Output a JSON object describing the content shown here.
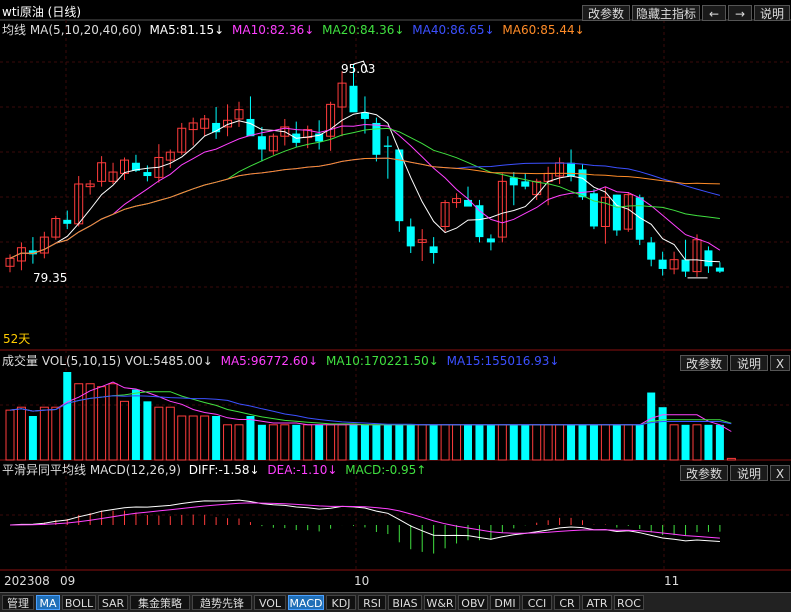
{
  "header": {
    "title": "wti原油 (日线)",
    "buttons": [
      "改参数",
      "隐藏主指标",
      "←",
      "→",
      "说明"
    ]
  },
  "ma_legend": {
    "label": "均线 MA(5,10,20,40,60)",
    "items": [
      {
        "text": "MA5:81.15↓",
        "color": "#ffffff"
      },
      {
        "text": "MA10:82.36↓",
        "color": "#ff40ff"
      },
      {
        "text": "MA20:84.36↓",
        "color": "#40e040"
      },
      {
        "text": "MA40:86.65↓",
        "color": "#3c50ff"
      },
      {
        "text": "MA60:85.44↓",
        "color": "#ff8c28"
      }
    ]
  },
  "price_annotations": {
    "high": "95.03",
    "low": "79.35",
    "days": "52天"
  },
  "vol_legend": {
    "label": "成交量 VOL(5,10,15) VOL:5485.00↓",
    "items": [
      {
        "text": "MA5:96772.60↓",
        "color": "#ff40ff"
      },
      {
        "text": "MA10:170221.50↓",
        "color": "#40e040"
      },
      {
        "text": "MA15:155016.93↓",
        "color": "#3c50ff"
      }
    ],
    "buttons": [
      "改参数",
      "说明",
      "X"
    ]
  },
  "macd_legend": {
    "label": "平滑异同平均线 MACD(12,26,9)",
    "items": [
      {
        "text": "DIFF:-1.58↓",
        "color": "#ffffff"
      },
      {
        "text": "DEA:-1.10↓",
        "color": "#ff40ff"
      },
      {
        "text": "MACD:-0.95↑",
        "color": "#40e040"
      }
    ],
    "buttons": [
      "改参数",
      "说明",
      "X"
    ]
  },
  "time_axis": {
    "labels": [
      "202308",
      "09",
      "10",
      "11"
    ]
  },
  "tabs": [
    "管理",
    "MA",
    "BOLL",
    "SAR",
    "集金策略",
    "趋势先锋",
    "VOL",
    "MACD",
    "KDJ",
    "RSI",
    "BIAS",
    "W&R",
    "OBV",
    "DMI",
    "CCI",
    "CR",
    "ATR",
    "ROC"
  ],
  "active_tabs": [
    "MA",
    "MACD"
  ],
  "chart_data": [
    {
      "type": "candlestick",
      "ylim": [
        75,
        97
      ],
      "candles": [
        {
          "o": 79.8,
          "h": 80.7,
          "l": 79.35,
          "c": 80.4
        },
        {
          "o": 80.2,
          "h": 81.6,
          "l": 79.5,
          "c": 81.2
        },
        {
          "o": 81.0,
          "h": 82.0,
          "l": 80.0,
          "c": 80.7
        },
        {
          "o": 80.8,
          "h": 82.4,
          "l": 80.4,
          "c": 82.0
        },
        {
          "o": 82.0,
          "h": 83.6,
          "l": 81.8,
          "c": 83.4
        },
        {
          "o": 83.3,
          "h": 84.0,
          "l": 82.6,
          "c": 83.0
        },
        {
          "o": 83.0,
          "h": 86.6,
          "l": 82.8,
          "c": 86.0
        },
        {
          "o": 85.8,
          "h": 86.3,
          "l": 85.2,
          "c": 86.0
        },
        {
          "o": 86.2,
          "h": 88.1,
          "l": 85.8,
          "c": 87.6
        },
        {
          "o": 86.2,
          "h": 87.6,
          "l": 86.0,
          "c": 86.9
        },
        {
          "o": 86.8,
          "h": 88.0,
          "l": 86.3,
          "c": 87.8
        },
        {
          "o": 87.6,
          "h": 88.2,
          "l": 86.9,
          "c": 87.0
        },
        {
          "o": 86.9,
          "h": 87.4,
          "l": 86.2,
          "c": 86.6
        },
        {
          "o": 86.5,
          "h": 89.0,
          "l": 86.1,
          "c": 88.0
        },
        {
          "o": 87.8,
          "h": 88.6,
          "l": 87.2,
          "c": 88.4
        },
        {
          "o": 88.4,
          "h": 90.6,
          "l": 88.2,
          "c": 90.2
        },
        {
          "o": 90.1,
          "h": 91.0,
          "l": 88.9,
          "c": 90.6
        },
        {
          "o": 90.2,
          "h": 91.2,
          "l": 89.6,
          "c": 90.9
        },
        {
          "o": 90.6,
          "h": 91.8,
          "l": 89.4,
          "c": 89.9
        },
        {
          "o": 90.3,
          "h": 92.0,
          "l": 89.6,
          "c": 90.8
        },
        {
          "o": 90.9,
          "h": 92.2,
          "l": 90.3,
          "c": 91.6
        },
        {
          "o": 90.9,
          "h": 92.6,
          "l": 90.1,
          "c": 89.6
        },
        {
          "o": 89.6,
          "h": 90.3,
          "l": 87.7,
          "c": 88.6
        },
        {
          "o": 88.5,
          "h": 89.8,
          "l": 88.2,
          "c": 89.6
        },
        {
          "o": 89.6,
          "h": 90.9,
          "l": 88.9,
          "c": 90.3
        },
        {
          "o": 89.8,
          "h": 90.7,
          "l": 88.8,
          "c": 89.1
        },
        {
          "o": 89.5,
          "h": 90.4,
          "l": 88.7,
          "c": 90.1
        },
        {
          "o": 89.8,
          "h": 90.8,
          "l": 88.6,
          "c": 89.2
        },
        {
          "o": 89.6,
          "h": 92.2,
          "l": 88.5,
          "c": 92.0
        },
        {
          "o": 91.8,
          "h": 94.5,
          "l": 89.6,
          "c": 93.6
        },
        {
          "o": 93.4,
          "h": 95.03,
          "l": 92.0,
          "c": 91.4
        },
        {
          "o": 91.4,
          "h": 92.6,
          "l": 89.8,
          "c": 90.9
        },
        {
          "o": 90.6,
          "h": 91.0,
          "l": 87.7,
          "c": 88.2
        },
        {
          "o": 88.9,
          "h": 89.6,
          "l": 86.4,
          "c": 88.8
        },
        {
          "o": 88.6,
          "h": 88.6,
          "l": 82.4,
          "c": 83.2
        },
        {
          "o": 82.8,
          "h": 83.4,
          "l": 80.8,
          "c": 81.3
        },
        {
          "o": 81.6,
          "h": 82.6,
          "l": 80.2,
          "c": 81.8
        },
        {
          "o": 81.3,
          "h": 82.0,
          "l": 80.0,
          "c": 80.8
        },
        {
          "o": 82.8,
          "h": 84.8,
          "l": 82.4,
          "c": 84.6
        },
        {
          "o": 84.6,
          "h": 85.3,
          "l": 84.2,
          "c": 84.9
        },
        {
          "o": 84.8,
          "h": 85.8,
          "l": 84.4,
          "c": 84.3
        },
        {
          "o": 84.4,
          "h": 84.8,
          "l": 81.6,
          "c": 82.0
        },
        {
          "o": 81.9,
          "h": 82.2,
          "l": 81.0,
          "c": 81.6
        },
        {
          "o": 82.0,
          "h": 86.8,
          "l": 81.6,
          "c": 86.2
        },
        {
          "o": 86.5,
          "h": 86.9,
          "l": 84.4,
          "c": 85.9
        },
        {
          "o": 86.2,
          "h": 86.8,
          "l": 85.6,
          "c": 85.8
        },
        {
          "o": 85.2,
          "h": 86.4,
          "l": 84.8,
          "c": 86.2
        },
        {
          "o": 86.2,
          "h": 87.3,
          "l": 84.4,
          "c": 86.8
        },
        {
          "o": 86.6,
          "h": 88.0,
          "l": 86.0,
          "c": 87.6
        },
        {
          "o": 87.6,
          "h": 88.6,
          "l": 86.2,
          "c": 86.6
        },
        {
          "o": 87.1,
          "h": 87.5,
          "l": 84.8,
          "c": 85.0
        },
        {
          "o": 85.3,
          "h": 85.6,
          "l": 82.6,
          "c": 82.8
        },
        {
          "o": 82.8,
          "h": 85.8,
          "l": 81.5,
          "c": 85.0
        },
        {
          "o": 85.2,
          "h": 85.2,
          "l": 82.1,
          "c": 82.5
        },
        {
          "o": 82.6,
          "h": 85.4,
          "l": 82.4,
          "c": 85.2
        },
        {
          "o": 85.0,
          "h": 85.2,
          "l": 81.4,
          "c": 81.8
        },
        {
          "o": 81.6,
          "h": 82.0,
          "l": 79.8,
          "c": 80.3
        },
        {
          "o": 80.3,
          "h": 80.9,
          "l": 79.1,
          "c": 79.6
        },
        {
          "o": 79.6,
          "h": 80.9,
          "l": 79.2,
          "c": 80.3
        },
        {
          "o": 80.3,
          "h": 81.8,
          "l": 79.0,
          "c": 79.4
        },
        {
          "o": 79.4,
          "h": 82.2,
          "l": 79.0,
          "c": 81.8
        },
        {
          "o": 81.0,
          "h": 81.3,
          "l": 79.3,
          "c": 79.8
        },
        {
          "o": 79.7,
          "h": 80.1,
          "l": 79.3,
          "c": 79.4
        }
      ]
    },
    {
      "type": "bar",
      "series": [
        {
          "name": "VOL",
          "values": [
            170000,
            180000,
            150000,
            180000,
            180000,
            300000,
            260000,
            260000,
            250000,
            260000,
            200000,
            240000,
            200000,
            180000,
            180000,
            150000,
            150000,
            150000,
            150000,
            120000,
            120000,
            150000,
            120000,
            120000,
            120000,
            120000,
            120000,
            120000,
            120000,
            120000,
            120000,
            120000,
            120000,
            120000,
            120000,
            120000,
            120000,
            120000,
            120000,
            120000,
            120000,
            120000,
            120000,
            120000,
            120000,
            120000,
            120000,
            120000,
            120000,
            120000,
            120000,
            120000,
            120000,
            120000,
            120000,
            120000,
            230000,
            180000,
            120000,
            120000,
            120000,
            120000,
            120000,
            5485
          ]
        }
      ]
    }
  ]
}
